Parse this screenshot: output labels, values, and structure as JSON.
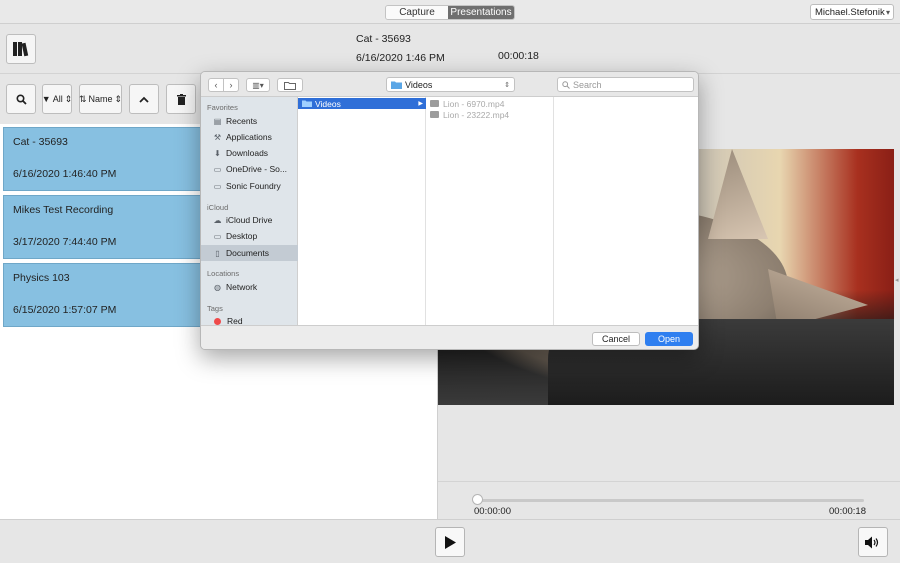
{
  "topbar": {
    "tabs": [
      {
        "label": "Capture"
      },
      {
        "label": "Presentations"
      }
    ],
    "user": "Michael.Stefonik"
  },
  "header": {
    "title": "Cat - 35693",
    "date": "6/16/2020 1:46 PM",
    "duration": "00:00:18"
  },
  "toolbar": {
    "filter_label": "All",
    "sort_label": "Name"
  },
  "recordings": [
    {
      "title": "Cat - 35693",
      "date": "6/16/2020 1:46:40 PM"
    },
    {
      "title": "Mikes Test Recording",
      "date": "3/17/2020 7:44:40 PM"
    },
    {
      "title": "Physics 103",
      "date": "6/15/2020 1:57:07 PM"
    }
  ],
  "player": {
    "current_time": "00:00:00",
    "total_time": "00:00:18",
    "progress": 0
  },
  "dialog": {
    "location": "Videos",
    "search_placeholder": "Search",
    "sidebar": {
      "favorites_header": "Favorites",
      "favorites": [
        {
          "label": "Recents",
          "icon": "recents-icon"
        },
        {
          "label": "Applications",
          "icon": "applications-icon"
        },
        {
          "label": "Downloads",
          "icon": "downloads-icon"
        },
        {
          "label": "OneDrive - So...",
          "icon": "folder-icon"
        },
        {
          "label": "Sonic Foundry",
          "icon": "folder-icon"
        }
      ],
      "icloud_header": "iCloud",
      "icloud": [
        {
          "label": "iCloud Drive",
          "icon": "cloud-icon"
        },
        {
          "label": "Desktop",
          "icon": "desktop-icon"
        },
        {
          "label": "Documents",
          "icon": "documents-icon"
        }
      ],
      "locations_header": "Locations",
      "locations": [
        {
          "label": "Network",
          "icon": "network-icon"
        }
      ],
      "tags_header": "Tags",
      "tags": [
        {
          "label": "Red",
          "color": "#ef4a4a"
        }
      ]
    },
    "column1": [
      {
        "label": "Videos"
      }
    ],
    "column2": [
      {
        "label": "Lion - 6970.mp4"
      },
      {
        "label": "Lion - 23222.mp4"
      }
    ],
    "cancel_label": "Cancel",
    "open_label": "Open"
  }
}
